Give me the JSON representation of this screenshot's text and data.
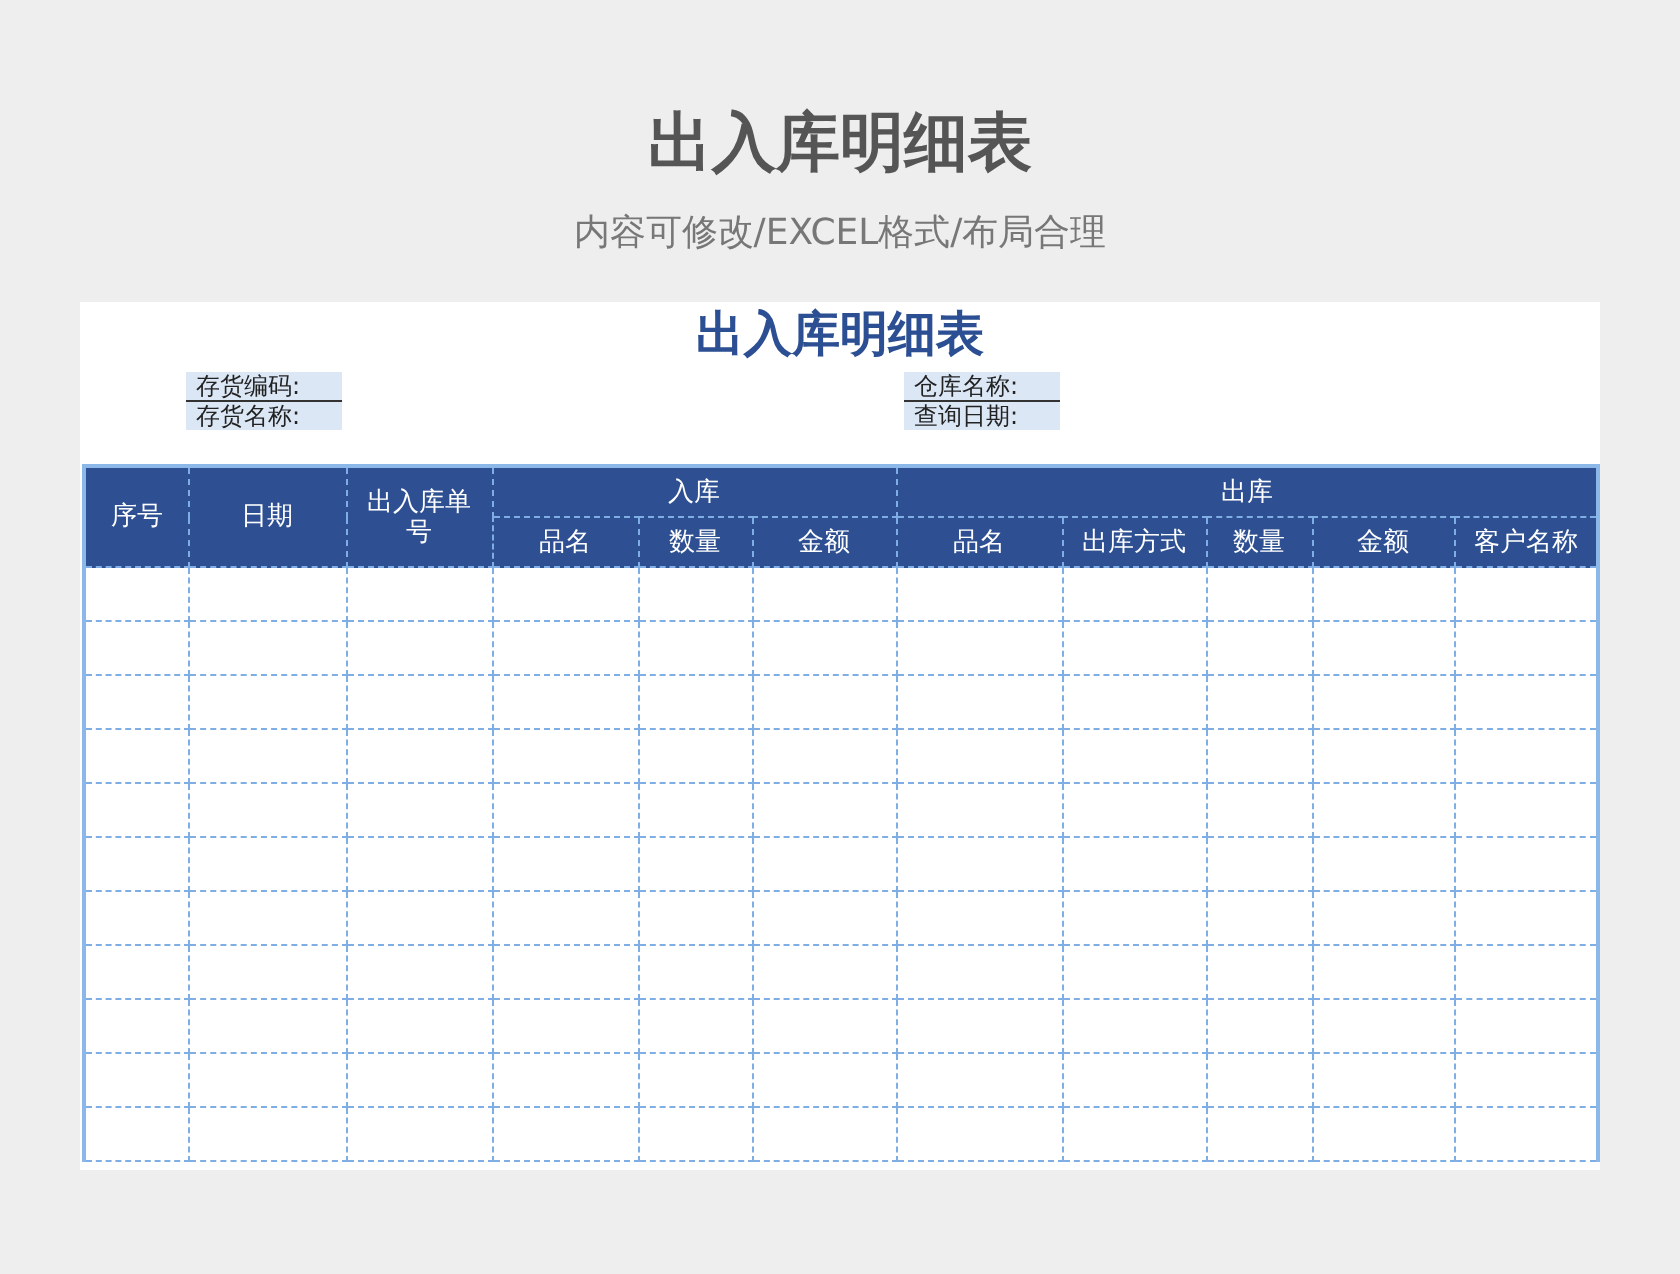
{
  "heading": "出入库明细表",
  "subtitle": "内容可修改/EXCEL格式/布局合理",
  "sheet": {
    "title": "出入库明细表",
    "info_left": [
      "存货编码:",
      "存货名称:"
    ],
    "info_right": [
      "仓库名称:",
      "查询日期:"
    ]
  },
  "table": {
    "columns": [
      {
        "label": "序号"
      },
      {
        "label": "日期"
      },
      {
        "label": "出入库单号"
      },
      {
        "group": "入库",
        "children": [
          "品名",
          "数量",
          "金额"
        ]
      },
      {
        "group": "出库",
        "children": [
          "品名",
          "出库方式",
          "数量",
          "金额",
          "客户名称"
        ]
      }
    ]
  }
}
